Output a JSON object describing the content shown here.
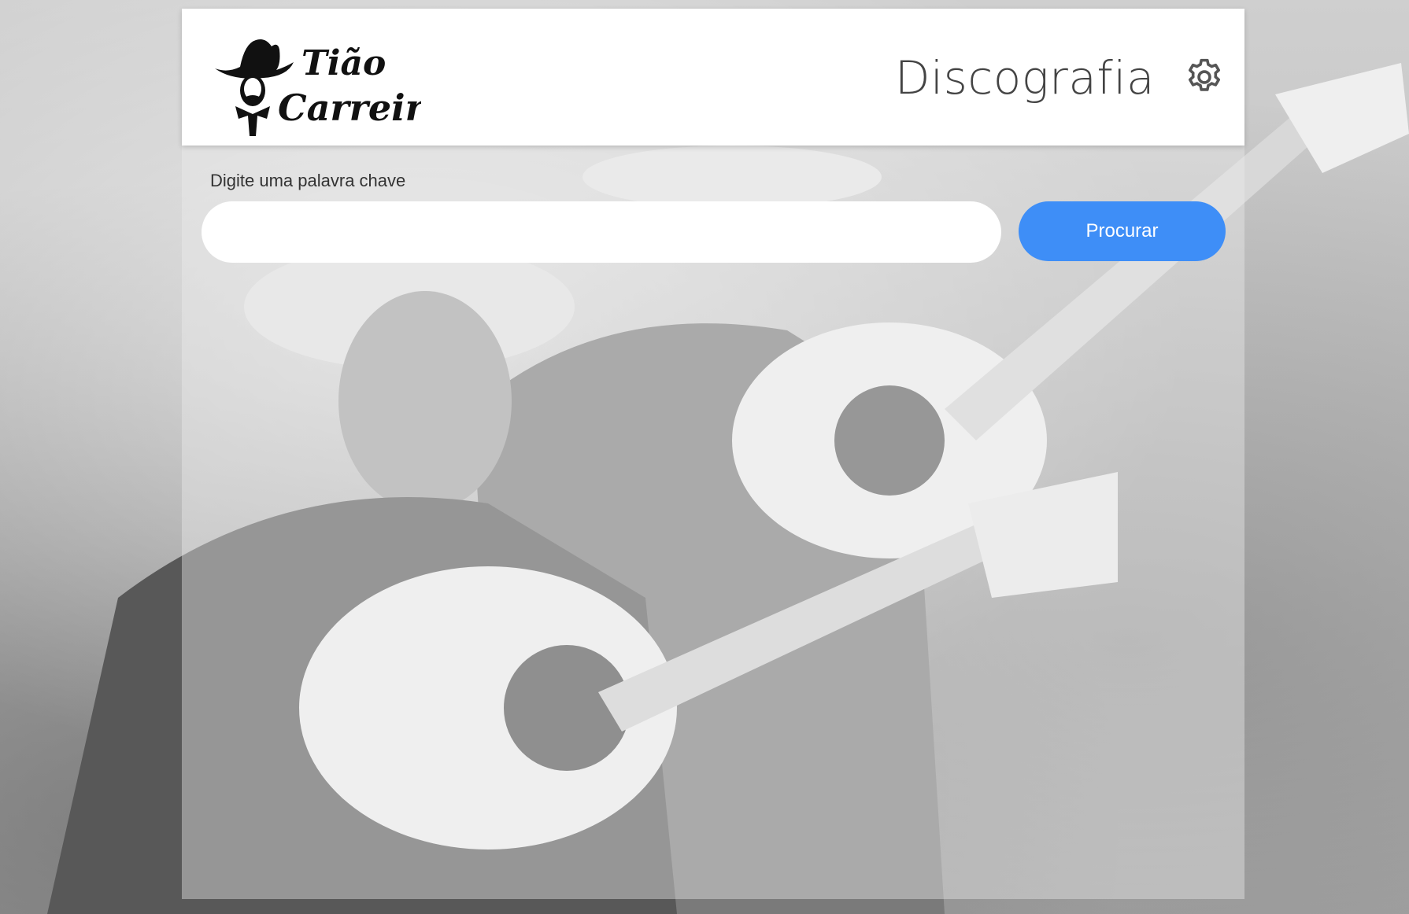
{
  "header": {
    "logo_text": "Tião Carreiro",
    "title": "Discografia",
    "settings_icon": "gear-icon"
  },
  "search": {
    "label": "Digite uma palavra chave",
    "value": "",
    "placeholder": "",
    "button_label": "Procurar"
  },
  "colors": {
    "accent": "#3e8ef7",
    "header_bg": "#ffffff",
    "title_text": "#444444"
  }
}
